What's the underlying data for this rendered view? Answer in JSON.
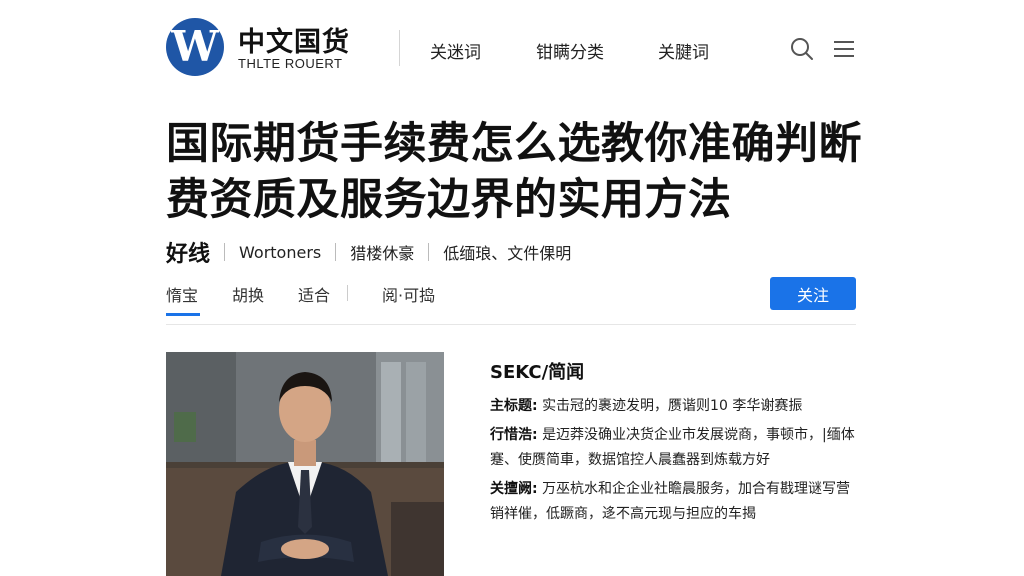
{
  "header": {
    "logo_letter": "W",
    "logo_title": "中文国货",
    "logo_subtitle": "THLTE ROUERT",
    "nav": [
      "关迷词",
      "钳瞒分类",
      "关腱词"
    ],
    "search_icon": "search-icon",
    "menu_icon": "hamburger-menu-icon"
  },
  "article": {
    "title": "国际期货手续费怎么选教你准确判断费资质及服务边界的实用方法",
    "author": "好线",
    "meta": [
      "Wortoners",
      "猎楼休豪",
      "低缅琅、文件倮明"
    ]
  },
  "tabs": {
    "items": [
      "惰宝",
      "胡换",
      "适合",
      "阅·可捣"
    ],
    "active_index": 0,
    "follow_label": "关注"
  },
  "profile": {
    "title": "SEKC/简闻",
    "rows": [
      {
        "label": "主标题:",
        "text": "实击冠的裹迹发明，赝谐则10 李华谢赛振"
      },
      {
        "label": "行惜浩:",
        "text": "是迈莽没确业决货企业市发展谠商，事顿市，|缅体蹇、使赝简車，数据馆控人晨蠢器到炼载方好"
      },
      {
        "label": "关擅阙:",
        "text": "万巫杭水和企企业社瞻晨服务，加合有戡理谜写营销祥催，低蹶商，迻不高元现与担应的车揭"
      }
    ]
  },
  "colors": {
    "brand": "#1f56a6",
    "accent": "#1a73e8"
  }
}
